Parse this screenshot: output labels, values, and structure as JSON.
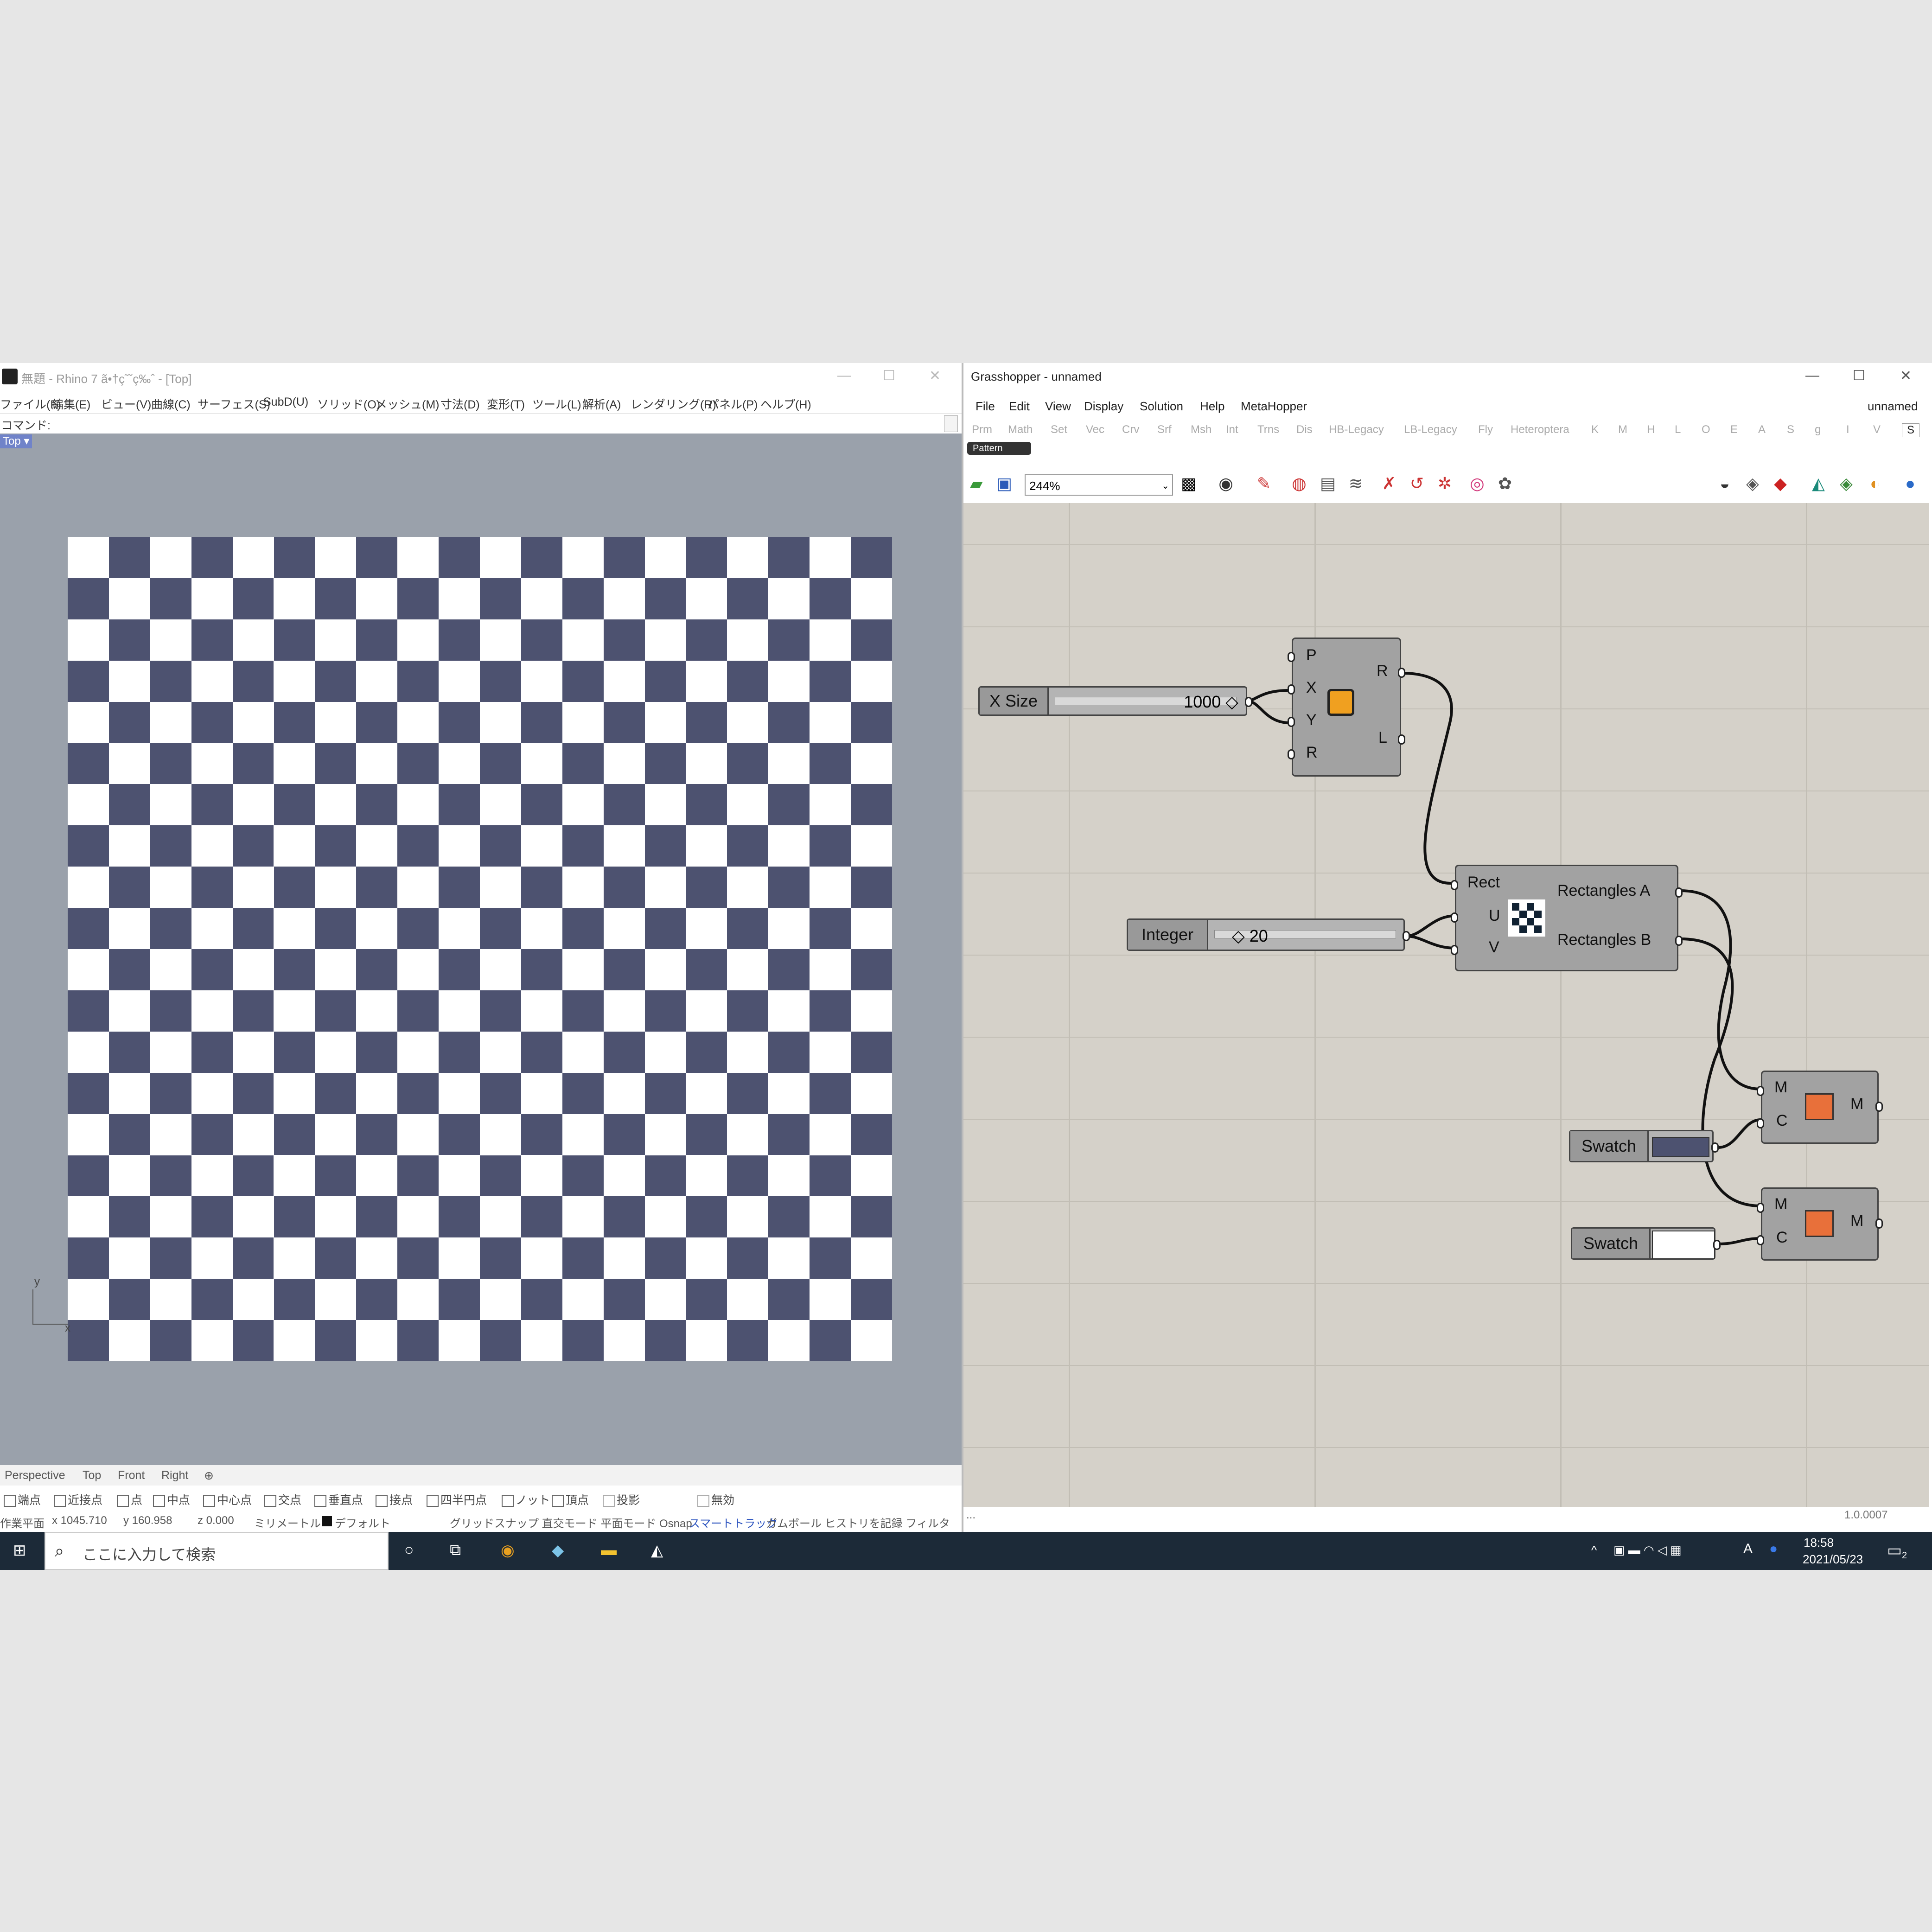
{
  "rhino": {
    "title": "無題 - Rhino 7 ã•†ç˜ˇç‰ˆ - [Top]",
    "menu": [
      "ファイル(F)",
      "編集(E)",
      "ビュー(V)",
      "曲線(C)",
      "サーフェス(S)",
      "SubD(U)",
      "ソリッド(O)",
      "メッシュ(M)",
      "寸法(D)",
      "変形(T)",
      "ツール(L)",
      "解析(A)",
      "レンダリング(R)",
      "パネル(P)",
      "ヘルプ(H)"
    ],
    "command_label": "コマンド:",
    "viewport_label": "Top ▾",
    "axis_y": "y",
    "axis_x": "x",
    "viewport_tabs": [
      "Perspective",
      "Top",
      "Front",
      "Right",
      "⊕"
    ],
    "osnaps": [
      "端点",
      "近接点",
      "点",
      "中点",
      "中心点",
      "交点",
      "垂直点",
      "接点",
      "四半円点",
      "ノット",
      "頂点",
      "投影",
      "無効"
    ],
    "status": {
      "cplane": "作業平面",
      "x": "x 1045.710",
      "y": "y 160.958",
      "z": "z 0.000",
      "units": "ミリメートル",
      "layer": "デフォルト",
      "modes": "グリッドスナップ 直交モード 平面モード Osnap",
      "smarttrack": "スマートトラック",
      "rest": "ガムボール ヒストリを記録 フィルタ"
    },
    "checker_colors": {
      "dark": "#4d5270",
      "light": "#ffffff"
    }
  },
  "gh": {
    "title": "Grasshopper - unnamed",
    "menu": [
      "File",
      "Edit",
      "View",
      "Display",
      "Solution",
      "Help",
      "MetaHopper"
    ],
    "doc_name": "unnamed",
    "tabs": [
      "Prm",
      "Math",
      "Set",
      "Vec",
      "Crv",
      "Srf",
      "Msh",
      "Int",
      "Trns",
      "Dis",
      "HB-Legacy",
      "LB-Legacy",
      "Fly",
      "Heteroptera",
      "K",
      "M",
      "H",
      "L",
      "O",
      "E",
      "A",
      "S",
      "g",
      "I",
      "V",
      "S"
    ],
    "pattern_tab": "Pattern",
    "zoom": "244%",
    "version": "1.0.0007",
    "status_left": "...",
    "xsize_slider": {
      "label": "X Size",
      "value": "1000 ◇"
    },
    "integer_slider": {
      "label": "Integer",
      "value": "◇ 20"
    },
    "rect_comp": {
      "inputs": [
        "P",
        "X",
        "Y",
        "R"
      ],
      "outputs": [
        "R",
        "L"
      ]
    },
    "checker_comp": {
      "inputs": [
        "Rect",
        "U",
        "V"
      ],
      "outputs": [
        "Rectangles A",
        "Rectangles B"
      ]
    },
    "preview1": {
      "inputs": [
        "M",
        "C"
      ],
      "output": "M"
    },
    "preview2": {
      "inputs": [
        "M",
        "C"
      ],
      "output": "M"
    },
    "swatch1": {
      "label": "Swatch",
      "color": "#4d5270"
    },
    "swatch2": {
      "label": "Swatch",
      "color": "#ffffff"
    }
  },
  "taskbar": {
    "search_placeholder": "ここに入力して検索",
    "time": "18:58",
    "date": "2021/05/23",
    "notifications": "2",
    "ime": "A"
  }
}
